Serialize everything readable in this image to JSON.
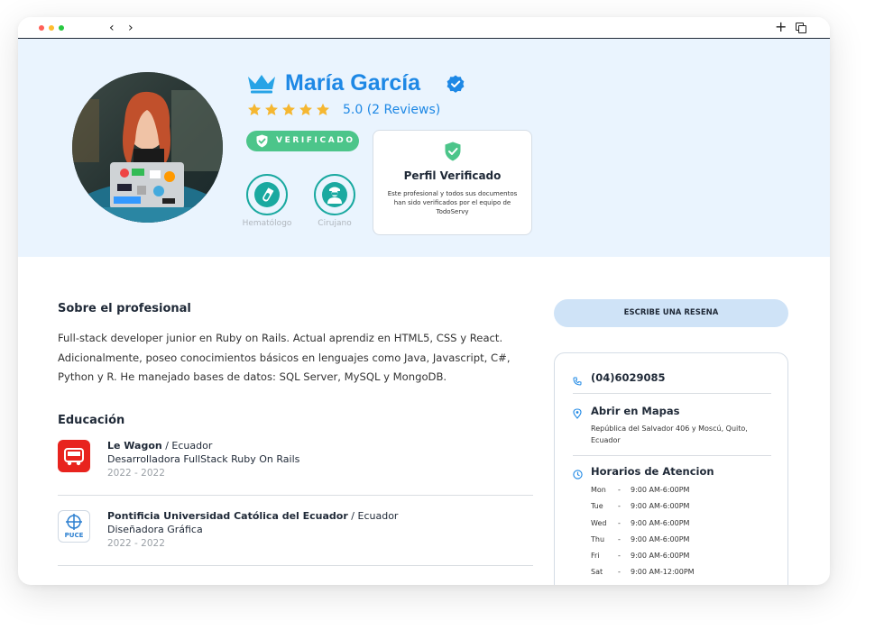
{
  "browser": {
    "back": "‹",
    "forward": "›",
    "new_tab": "+"
  },
  "profile": {
    "name": "María García",
    "rating_text": "5.0 (2 Reviews)",
    "rating": 5,
    "verified_badge": "VERIFICADO",
    "specialties": [
      {
        "label": "Hematólogo",
        "icon": "test-tube-icon"
      },
      {
        "label": "Cirujano",
        "icon": "surgeon-icon"
      }
    ],
    "verified_card": {
      "title": "Perfil Verificado",
      "description": "Este profesional y todos sus documentos han sido verificados por el equipo de TodoServy"
    }
  },
  "about": {
    "title": "Sobre el profesional",
    "text": "Full-stack developer junior en Ruby on Rails. Actual aprendiz en HTML5, CSS y React. Adicionalmente, poseo conocimientos básicos en lenguajes como Java, Javascript, C#, Python y R. He manejado bases de datos: SQL Server, MySQL y MongoDB."
  },
  "education": {
    "title": "Educación",
    "items": [
      {
        "institution": "Le Wagon",
        "country": " / Ecuador",
        "degree": "Desarrolladora FullStack Ruby On Rails",
        "years": "2022 - 2022",
        "logo_text": ""
      },
      {
        "institution": "Pontificia Universidad Católica del Ecuador",
        "country": " / Ecuador",
        "degree": "Diseñadora Gráfica",
        "years": "2022 - 2022",
        "logo_text": "PUCE"
      }
    ]
  },
  "sidebar": {
    "review_button": "ESCRIBE UNA RESENA",
    "phone": "(04)6029085",
    "maps_title": "Abrir en Mapas",
    "address": "República del Salvador 406 y Moscú, Quito, Ecuador",
    "hours_title": "Horarios de Atencion",
    "hours": [
      {
        "day": "Mon",
        "sep": "-",
        "time": "9:00 AM-6:00PM"
      },
      {
        "day": "Tue",
        "sep": "-",
        "time": "9:00 AM-6:00PM"
      },
      {
        "day": "Wed",
        "sep": "-",
        "time": "9:00 AM-6:00PM"
      },
      {
        "day": "Thu",
        "sep": "-",
        "time": "9:00 AM-6:00PM"
      },
      {
        "day": "Fri",
        "sep": "-",
        "time": "9:00 AM-6:00PM"
      },
      {
        "day": "Sat",
        "sep": "-",
        "time": "9:00 AM-12:00PM"
      }
    ]
  },
  "colors": {
    "accent": "#1e88e5",
    "hero_bg": "#eaf4fe",
    "verified_green": "#4cc58a",
    "teal": "#1aa9a0",
    "star": "#f5b731",
    "lewagon_red": "#e8231e"
  }
}
